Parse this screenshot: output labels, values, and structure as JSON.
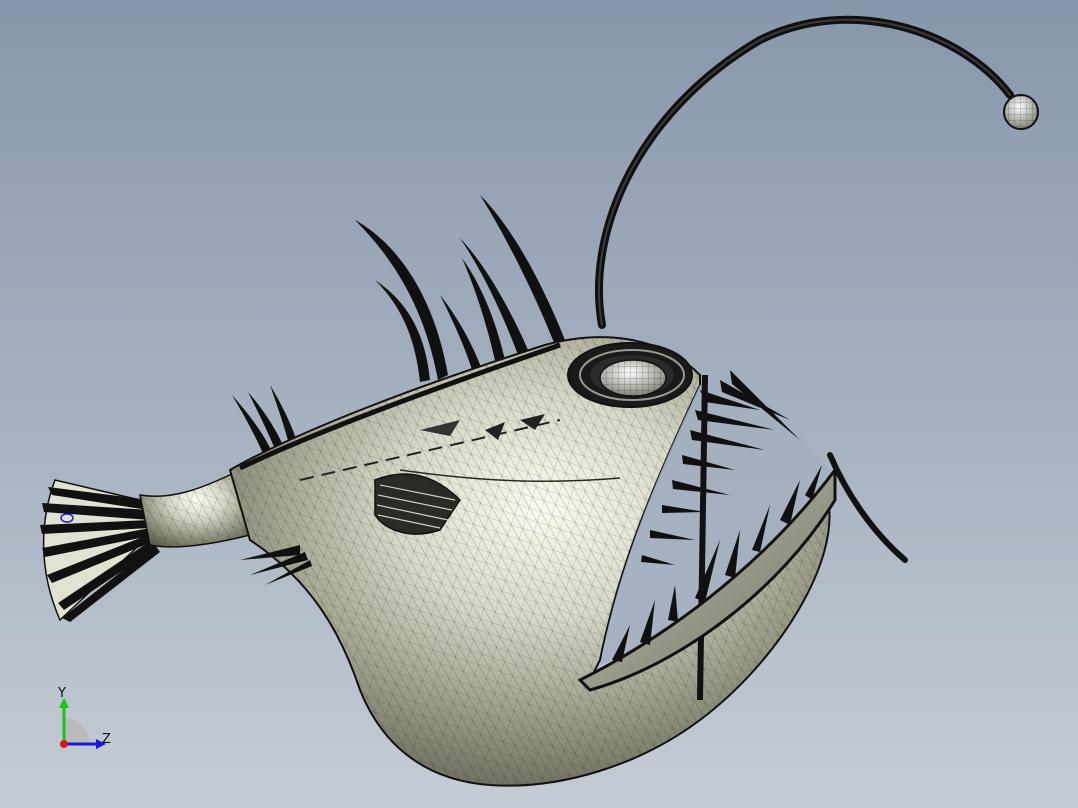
{
  "viewport": {
    "background_top": "#8797ab",
    "background_bottom": "#c5ccd5"
  },
  "model": {
    "subject": "anglerfish",
    "display_mode": "shaded-with-edges",
    "surface_color": "#e6e6da",
    "edge_color": "#111111"
  },
  "triad": {
    "y_label": "Y",
    "z_label": "Z",
    "y_color": "#19c419",
    "z_color": "#1a1ad6",
    "x_color": "#d41a1a"
  }
}
